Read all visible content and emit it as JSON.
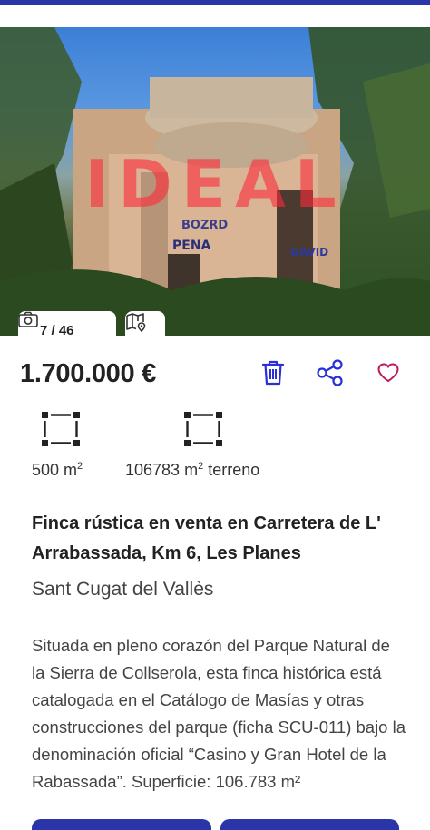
{
  "gallery": {
    "counter": "7 / 46",
    "watermark": "IDEAL",
    "camera_icon": "camera-icon",
    "map_icon": "map-pin-icon"
  },
  "listing": {
    "price": "1.700.000 €",
    "features": [
      {
        "icon": "area-icon",
        "value": "500 m",
        "unit_sup": "2",
        "suffix": ""
      },
      {
        "icon": "area-icon",
        "value": "106783 m",
        "unit_sup": "2",
        "suffix": " terreno"
      }
    ],
    "title": "Finca rústica en venta en Carretera de L' Arrabassada, Km 6, Les Planes",
    "location": "Sant Cugat del Vallès",
    "description": "Situada en pleno corazón del Parque Natural de la Sierra de Collserola, esta finca histórica está catalogada en el Catálogo de Masías y otras construcciones del parque (ficha SCU-011) bajo la denominación oficial “Casino y Gran Hotel de la Rabassada”. Superficie: 106.783 m²"
  },
  "actions": {
    "delete_icon": "trash-icon",
    "share_icon": "share-icon",
    "favorite_icon": "heart-icon"
  },
  "colors": {
    "accent": "#2a35a8",
    "icon_blue": "#2b2fd6",
    "heart": "#c2185b"
  }
}
